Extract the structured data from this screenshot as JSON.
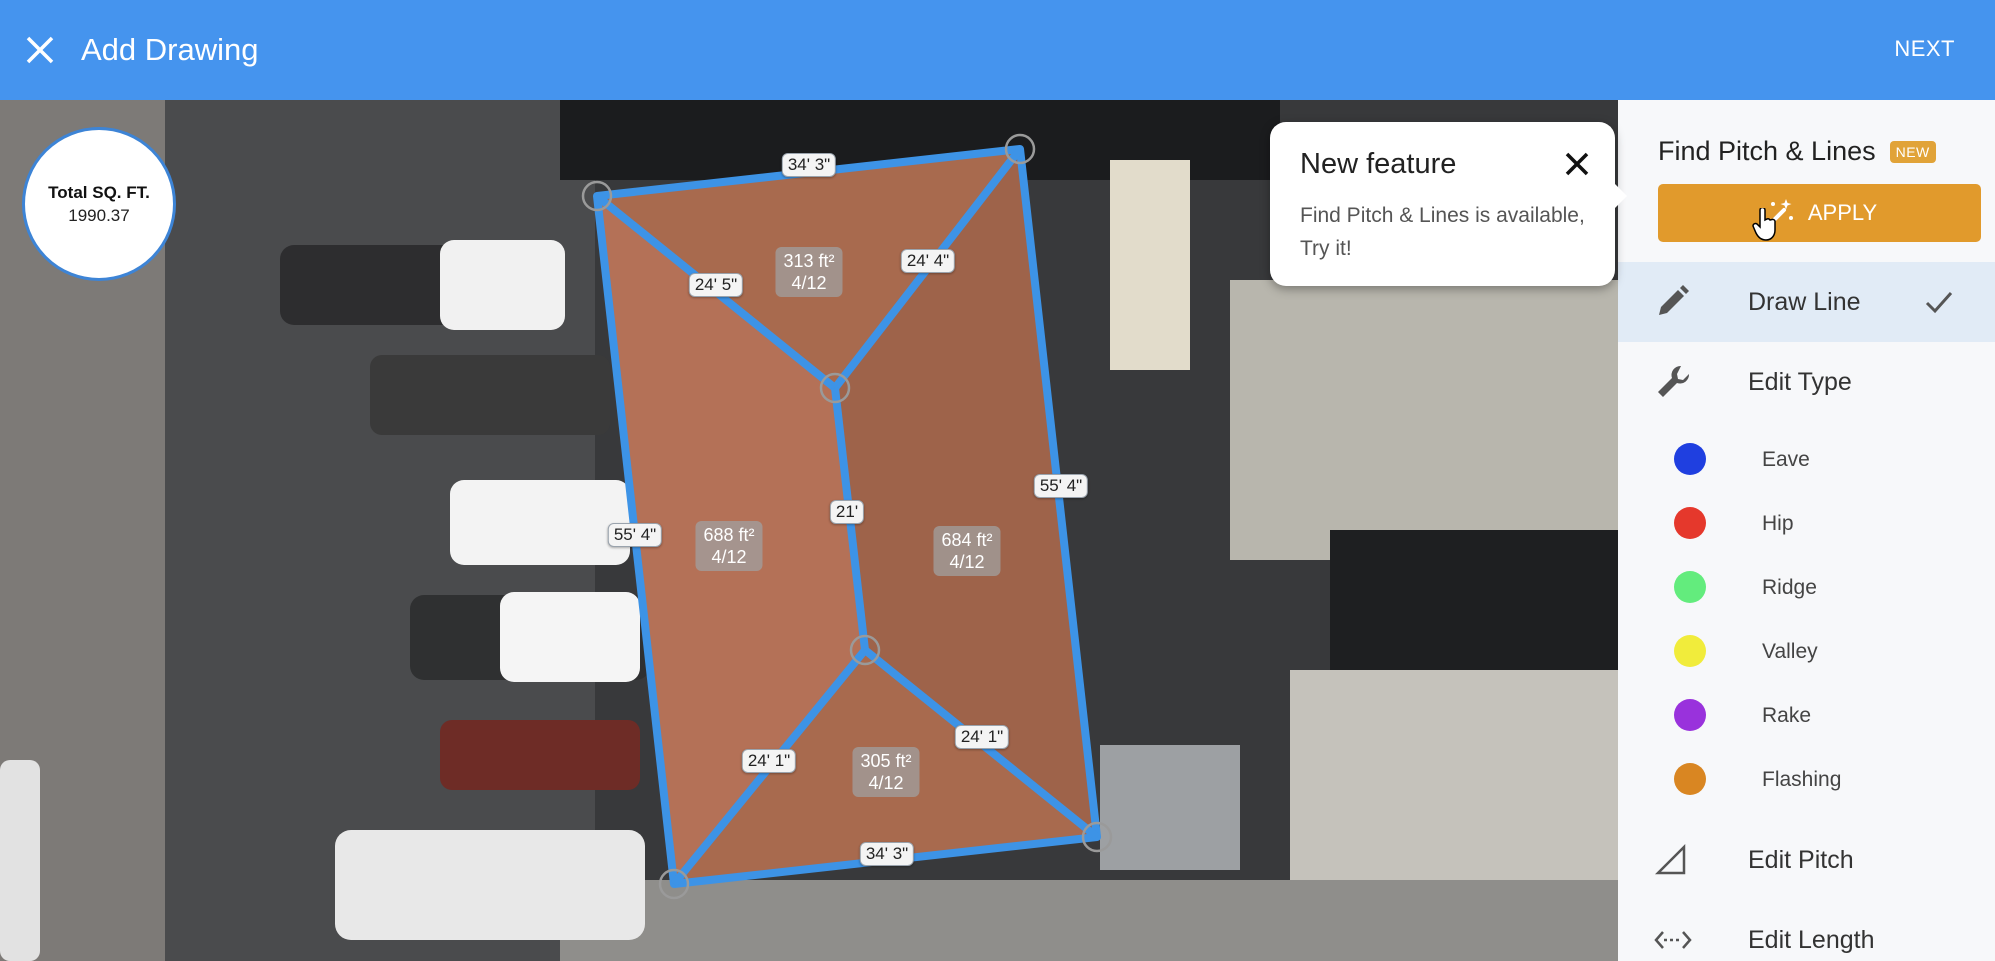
{
  "header": {
    "title": "Add Drawing",
    "next_label": "NEXT"
  },
  "map": {
    "total_label": "Total SQ. FT.",
    "total_value": "1990.37",
    "edge_labels": {
      "top": "34' 3\"",
      "bottom": "34' 3\"",
      "left": "55' 4\"",
      "right": "55' 4\"",
      "ridge": "21'",
      "hip_tl": "24' 5\"",
      "hip_tr": "24' 4\"",
      "hip_bl": "24' 1\"",
      "hip_br": "24' 1\""
    },
    "facets": [
      {
        "area": "313 ft²",
        "pitch": "4/12"
      },
      {
        "area": "688 ft²",
        "pitch": "4/12"
      },
      {
        "area": "684 ft²",
        "pitch": "4/12"
      },
      {
        "area": "305 ft²",
        "pitch": "4/12"
      }
    ]
  },
  "popover": {
    "title": "New feature",
    "body": "Find Pitch & Lines is available, Try it!"
  },
  "panel": {
    "title": "Find Pitch & Lines",
    "badge": "NEW",
    "apply_label": "APPLY",
    "tools": {
      "draw_line": "Draw Line",
      "edit_type": "Edit Type",
      "edit_pitch": "Edit Pitch",
      "edit_length": "Edit Length"
    },
    "line_types": [
      {
        "name": "Eave",
        "color": "#1f3fe0"
      },
      {
        "name": "Hip",
        "color": "#e5382c"
      },
      {
        "name": "Ridge",
        "color": "#63ec7d"
      },
      {
        "name": "Valley",
        "color": "#f1ec3b"
      },
      {
        "name": "Rake",
        "color": "#9932dc"
      },
      {
        "name": "Flashing",
        "color": "#d98622"
      }
    ]
  },
  "colors": {
    "header": "#4594ee",
    "roof_line": "#3d93e6",
    "apply": "#e19a2c"
  }
}
